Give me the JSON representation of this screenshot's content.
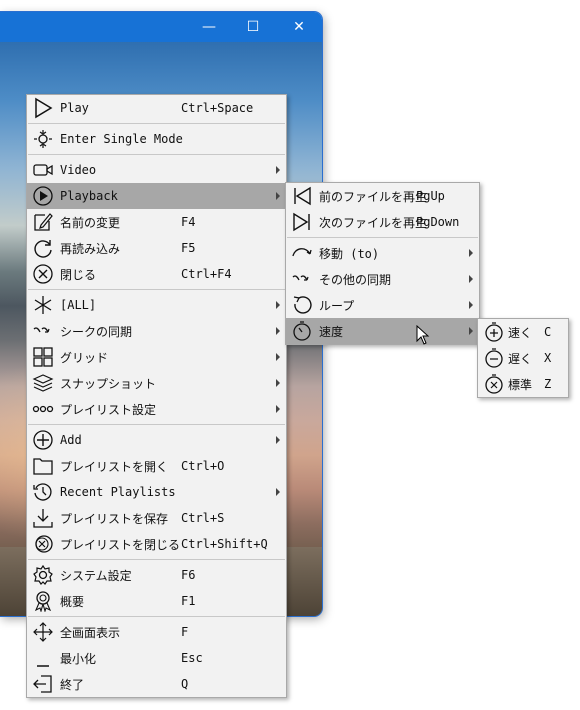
{
  "window": {
    "minimize_glyph": "—",
    "maximize_glyph": "☐",
    "close_glyph": "✕"
  },
  "main_menu": {
    "items": [
      {
        "label": "Play",
        "shortcut": "Ctrl+Space",
        "icon": "play-icon"
      },
      {
        "label": "Enter Single Mode",
        "shortcut": "",
        "icon": "single-mode-icon"
      },
      {
        "label": "Video",
        "shortcut": "",
        "icon": "video-camera-icon",
        "submenu": true
      },
      {
        "label": "Playback",
        "shortcut": "",
        "icon": "playback-circle-icon",
        "submenu": true,
        "highlighted": true
      },
      {
        "label": "名前の変更",
        "shortcut": "F4",
        "icon": "rename-icon"
      },
      {
        "label": "再読み込み",
        "shortcut": "F5",
        "icon": "reload-icon"
      },
      {
        "label": "閉じる",
        "shortcut": "Ctrl+F4",
        "icon": "close-circle-icon"
      },
      {
        "label": "[ALL]",
        "shortcut": "",
        "icon": "asterisk-icon",
        "submenu": true
      },
      {
        "label": "シークの同期",
        "shortcut": "",
        "icon": "seek-sync-icon",
        "submenu": true
      },
      {
        "label": "グリッド",
        "shortcut": "",
        "icon": "grid-icon",
        "submenu": true
      },
      {
        "label": "スナップショット",
        "shortcut": "",
        "icon": "snapshot-layers-icon",
        "submenu": true
      },
      {
        "label": "プレイリスト設定",
        "shortcut": "",
        "icon": "playlist-settings-icon",
        "submenu": true
      },
      {
        "label": "Add",
        "shortcut": "",
        "icon": "add-circle-icon",
        "submenu": true
      },
      {
        "label": "プレイリストを開く",
        "shortcut": "Ctrl+O",
        "icon": "folder-icon"
      },
      {
        "label": "Recent Playlists",
        "shortcut": "",
        "icon": "history-icon",
        "submenu": true
      },
      {
        "label": "プレイリストを保存",
        "shortcut": "Ctrl+S",
        "icon": "save-download-icon"
      },
      {
        "label": "プレイリストを閉じる",
        "shortcut": "Ctrl+Shift+Q",
        "icon": "close-playlist-icon"
      },
      {
        "label": "システム設定",
        "shortcut": "F6",
        "icon": "gear-icon"
      },
      {
        "label": "概要",
        "shortcut": "F1",
        "icon": "about-award-icon"
      },
      {
        "label": "全画面表示",
        "shortcut": "F",
        "icon": "fullscreen-arrows-icon"
      },
      {
        "label": "最小化",
        "shortcut": "Esc",
        "icon": "minimize-icon"
      },
      {
        "label": "終了",
        "shortcut": "Q",
        "icon": "exit-icon"
      }
    ]
  },
  "playback_menu": {
    "items": [
      {
        "label": "前のファイルを再生",
        "shortcut": "PgUp",
        "icon": "previous-file-icon"
      },
      {
        "label": "次のファイルを再生",
        "shortcut": "PgDown",
        "icon": "next-file-icon"
      },
      {
        "label": "移動 (to)",
        "shortcut": "",
        "icon": "move-to-icon",
        "submenu": true
      },
      {
        "label": "その他の同期",
        "shortcut": "",
        "icon": "other-sync-icon",
        "submenu": true
      },
      {
        "label": "ループ",
        "shortcut": "",
        "icon": "loop-icon",
        "submenu": true
      },
      {
        "label": "速度",
        "shortcut": "",
        "icon": "speed-timer-icon",
        "submenu": true,
        "highlighted": true
      }
    ]
  },
  "speed_menu": {
    "items": [
      {
        "label": "速く",
        "shortcut": "C",
        "icon": "faster-icon"
      },
      {
        "label": "遅く",
        "shortcut": "X",
        "icon": "slower-icon"
      },
      {
        "label": "標準",
        "shortcut": "Z",
        "icon": "normal-speed-icon"
      }
    ]
  },
  "colors": {
    "titlebar": "#1772d6",
    "menu_bg": "#f2f2f2",
    "highlight": "#a7a7a7"
  }
}
